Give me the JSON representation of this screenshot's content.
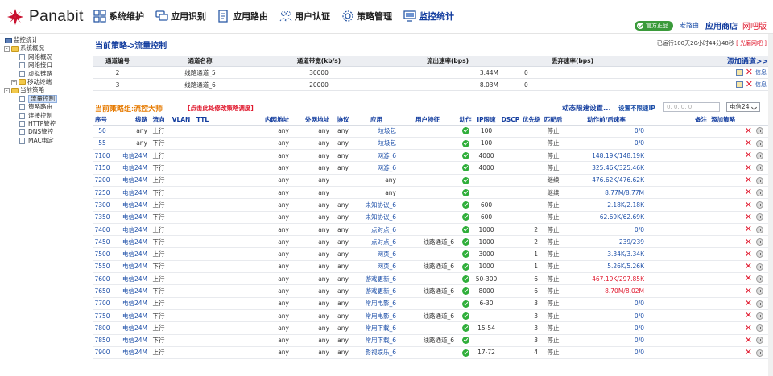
{
  "app": {
    "logo_text": "Panabit",
    "nav": [
      {
        "label": "系统维护",
        "icon": "grid-icon"
      },
      {
        "label": "应用识别",
        "icon": "chat-icon"
      },
      {
        "label": "应用路由",
        "icon": "document-icon"
      },
      {
        "label": "用户认证",
        "icon": "users-icon"
      },
      {
        "label": "策略管理",
        "icon": "gear-icon"
      },
      {
        "label": "监控统计",
        "icon": "monitor-icon"
      }
    ],
    "badge": "官方正品",
    "old_route": "老路由",
    "store": "应用商店",
    "cafe": "网吧版"
  },
  "sidebar": [
    {
      "label": "监控统计",
      "level": 0,
      "type": "pc",
      "expander": ""
    },
    {
      "label": "系统概况",
      "level": 0,
      "type": "folder",
      "expander": "-"
    },
    {
      "label": "网络概况",
      "level": 2,
      "type": "page",
      "expander": ""
    },
    {
      "label": "网络接口",
      "level": 2,
      "type": "page",
      "expander": ""
    },
    {
      "label": "虚拟链路",
      "level": 2,
      "type": "page",
      "expander": ""
    },
    {
      "label": "移动终端",
      "level": 1,
      "type": "folder",
      "expander": "+"
    },
    {
      "label": "当前策略",
      "level": 0,
      "type": "folder",
      "expander": "-"
    },
    {
      "label": "流量控制",
      "level": 2,
      "type": "page",
      "expander": "",
      "selected": true
    },
    {
      "label": "策略路由",
      "level": 2,
      "type": "page",
      "expander": ""
    },
    {
      "label": "连接控制",
      "level": 2,
      "type": "page",
      "expander": ""
    },
    {
      "label": "HTTP管控",
      "level": 2,
      "type": "page",
      "expander": ""
    },
    {
      "label": "DNS管控",
      "level": 2,
      "type": "page",
      "expander": ""
    },
    {
      "label": "MAC绑定",
      "level": 2,
      "type": "page",
      "expander": ""
    }
  ],
  "main": {
    "title": "当前策略->流量控制",
    "uptime_prefix": "已运行100天20小时44分48秒 ",
    "uptime_tag": "[ 光磨网吧 ]",
    "channels": {
      "headers": [
        "通道编号",
        "通道名称",
        "通道带宽(kb/s)",
        "流出速率(bps)",
        "丢弃速率(bps)"
      ],
      "add_label": "添加通道>>",
      "rows": [
        {
          "id": "2",
          "name": "线路通道_5",
          "bw": "30000",
          "out": "3.44M",
          "drop": "0",
          "info": "信息"
        },
        {
          "id": "3",
          "name": "线路通道_6",
          "bw": "20000",
          "out": "8.03M",
          "drop": "0",
          "info": "信息"
        }
      ]
    },
    "policy": {
      "group_title": "当前策略组:流控大师",
      "group_link": "[点击此处修改策略调度]",
      "dynamic": "动态限速设置...",
      "nolimit": "设置不限速IP",
      "ip_placeholder": "0. 0. 0. 0",
      "select_value": "电信24",
      "headers": {
        "no": "序号",
        "line": "线路",
        "dir": "流向",
        "vlan": "VLAN",
        "ttl": "TTL",
        "inner": "内网地址",
        "outer": "外网地址",
        "proto": "协议",
        "app": "应用",
        "user": "用户特征",
        "action": "动作",
        "iplimit": "IP限速",
        "dscp": "DSCP",
        "prio": "优先级",
        "after": "匹配后",
        "rate": "动作前/后速率",
        "note": "备注",
        "add": "添加策略"
      },
      "rows": [
        {
          "no": "50",
          "line": "any",
          "dir": "上行",
          "inner": "any",
          "outer": "any",
          "proto": "any",
          "app": "垃圾包",
          "action": "",
          "iplimit": "100",
          "prio": "",
          "after": "停止",
          "rate": "0/0",
          "rate_color": "blue"
        },
        {
          "no": "55",
          "line": "any",
          "dir": "下行",
          "inner": "any",
          "outer": "any",
          "proto": "any",
          "app": "垃圾包",
          "action": "",
          "iplimit": "100",
          "prio": "",
          "after": "停止",
          "rate": "0/0",
          "rate_color": "blue"
        },
        {
          "no": "7100",
          "line": "电信24M",
          "dir": "上行",
          "inner": "any",
          "outer": "any",
          "proto": "any",
          "app": "网游_6",
          "action": "",
          "iplimit": "4000",
          "prio": "",
          "after": "停止",
          "rate": "148.19K/148.19K",
          "rate_color": "blue"
        },
        {
          "no": "7150",
          "line": "电信24M",
          "dir": "下行",
          "inner": "any",
          "outer": "any",
          "proto": "any",
          "app": "网游_6",
          "action": "",
          "iplimit": "4000",
          "prio": "",
          "after": "停止",
          "rate": "325.46K/325.46K",
          "rate_color": "blue"
        },
        {
          "no": "7200",
          "line": "电信24M",
          "dir": "上行",
          "inner": "any",
          "outer": "any",
          "proto": "",
          "app": "any",
          "action": "",
          "iplimit": "",
          "prio": "",
          "after": "继续",
          "rate": "476.62K/476.62K",
          "rate_color": "blue"
        },
        {
          "no": "7250",
          "line": "电信24M",
          "dir": "下行",
          "inner": "any",
          "outer": "any",
          "proto": "",
          "app": "any",
          "action": "",
          "iplimit": "",
          "prio": "",
          "after": "继续",
          "rate": "8.77M/8.77M",
          "rate_color": "blue"
        },
        {
          "no": "7300",
          "line": "电信24M",
          "dir": "上行",
          "inner": "any",
          "outer": "any",
          "proto": "any",
          "app": "未知协议_6",
          "action": "",
          "iplimit": "600",
          "prio": "",
          "after": "停止",
          "rate": "2.18K/2.18K",
          "rate_color": "blue"
        },
        {
          "no": "7350",
          "line": "电信24M",
          "dir": "下行",
          "inner": "any",
          "outer": "any",
          "proto": "any",
          "app": "未知协议_6",
          "action": "",
          "iplimit": "600",
          "prio": "",
          "after": "停止",
          "rate": "62.69K/62.69K",
          "rate_color": "blue"
        },
        {
          "no": "7400",
          "line": "电信24M",
          "dir": "上行",
          "inner": "any",
          "outer": "any",
          "proto": "any",
          "app": "点对点_6",
          "action": "",
          "iplimit": "1000",
          "prio": "2",
          "after": "停止",
          "rate": "0/0",
          "rate_color": "blue"
        },
        {
          "no": "7450",
          "line": "电信24M",
          "dir": "下行",
          "inner": "any",
          "outer": "any",
          "proto": "any",
          "app": "点对点_6",
          "action": "线路通道_6",
          "iplimit": "1000",
          "prio": "2",
          "after": "停止",
          "rate": "239/239",
          "rate_color": "blue"
        },
        {
          "no": "7500",
          "line": "电信24M",
          "dir": "上行",
          "inner": "any",
          "outer": "any",
          "proto": "any",
          "app": "网页_6",
          "action": "",
          "iplimit": "3000",
          "prio": "1",
          "after": "停止",
          "rate": "3.34K/3.34K",
          "rate_color": "blue"
        },
        {
          "no": "7550",
          "line": "电信24M",
          "dir": "下行",
          "inner": "any",
          "outer": "any",
          "proto": "any",
          "app": "网页_6",
          "action": "线路通道_6",
          "iplimit": "1000",
          "prio": "1",
          "after": "停止",
          "rate": "5.26K/5.26K",
          "rate_color": "blue"
        },
        {
          "no": "7600",
          "line": "电信24M",
          "dir": "上行",
          "inner": "any",
          "outer": "any",
          "proto": "any",
          "app": "游戏更新_6",
          "action": "",
          "iplimit": "50-300",
          "prio": "6",
          "after": "停止",
          "rate": "467.19K/297.85K",
          "rate_color": "red"
        },
        {
          "no": "7650",
          "line": "电信24M",
          "dir": "下行",
          "inner": "any",
          "outer": "any",
          "proto": "any",
          "app": "游戏更新_6",
          "action": "线路通道_6",
          "iplimit": "8000",
          "prio": "6",
          "after": "停止",
          "rate": "8.70M/8.02M",
          "rate_color": "red"
        },
        {
          "no": "7700",
          "line": "电信24M",
          "dir": "上行",
          "inner": "any",
          "outer": "any",
          "proto": "any",
          "app": "常用电影_6",
          "action": "",
          "iplimit": "6-30",
          "prio": "3",
          "after": "停止",
          "rate": "0/0",
          "rate_color": "blue"
        },
        {
          "no": "7750",
          "line": "电信24M",
          "dir": "下行",
          "inner": "any",
          "outer": "any",
          "proto": "any",
          "app": "常用电影_6",
          "action": "线路通道_6",
          "iplimit": "",
          "prio": "3",
          "after": "停止",
          "rate": "0/0",
          "rate_color": "blue"
        },
        {
          "no": "7800",
          "line": "电信24M",
          "dir": "上行",
          "inner": "any",
          "outer": "any",
          "proto": "any",
          "app": "常用下载_6",
          "action": "",
          "iplimit": "15-54",
          "prio": "3",
          "after": "停止",
          "rate": "0/0",
          "rate_color": "blue"
        },
        {
          "no": "7850",
          "line": "电信24M",
          "dir": "下行",
          "inner": "any",
          "outer": "any",
          "proto": "any",
          "app": "常用下载_6",
          "action": "线路通道_6",
          "iplimit": "",
          "prio": "3",
          "after": "停止",
          "rate": "0/0",
          "rate_color": "blue"
        },
        {
          "no": "7900",
          "line": "电信24M",
          "dir": "上行",
          "inner": "any",
          "outer": "any",
          "proto": "any",
          "app": "影视娱乐_6",
          "action": "",
          "iplimit": "17-72",
          "prio": "4",
          "after": "停止",
          "rate": "0/0",
          "rate_color": "blue"
        }
      ]
    }
  }
}
